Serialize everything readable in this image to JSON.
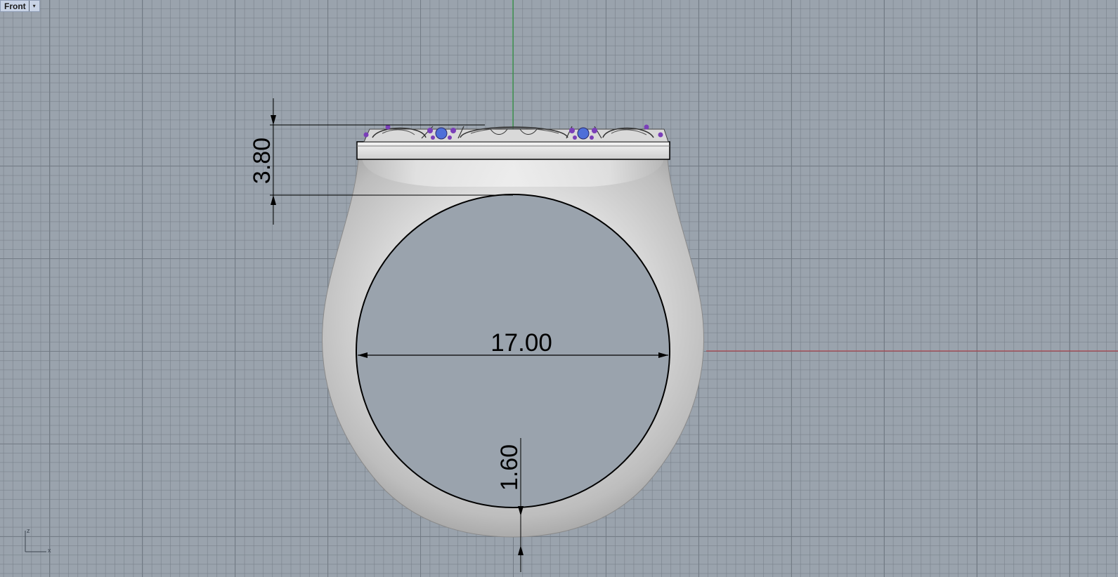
{
  "viewport": {
    "name": "Front",
    "menu_glyph": "▾"
  },
  "dimensions": {
    "top_height": "3.80",
    "inner_diameter": "17.00",
    "band_thickness": "1.60"
  },
  "axis_indicator": {
    "vertical_axis": "z",
    "horizontal_axis": "x"
  },
  "colors": {
    "viewport_background": "#9aa3ad",
    "x_axis": "#b8323a",
    "z_axis": "#1f9a2e",
    "metal": "#dcdcdc",
    "gem_purple": "#7a3fb8",
    "gem_blue": "#4e6fd8"
  }
}
